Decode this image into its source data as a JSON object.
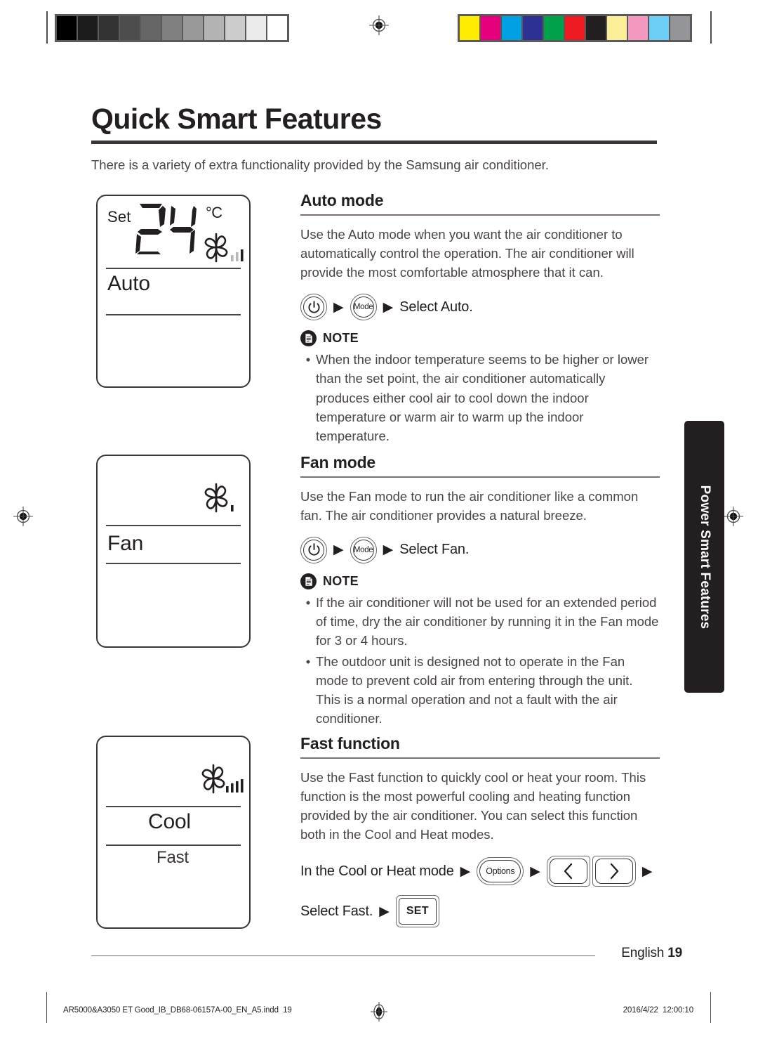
{
  "document": {
    "title": "Quick Smart Features",
    "intro": "There is a variety of extra functionality provided by the Samsung air conditioner.",
    "page_label": "English",
    "page_number": "19",
    "side_tab_label": "Power Smart Features"
  },
  "prepress": {
    "grayscale_swatches": [
      "#000000",
      "#1c1c1c",
      "#333333",
      "#4d4d4d",
      "#666666",
      "#808080",
      "#999999",
      "#b3b3b3",
      "#cccccc",
      "#ebebeb",
      "#ffffff"
    ],
    "color_swatches": [
      "#ffec00",
      "#e5007d",
      "#00a0e2",
      "#2e3192",
      "#00a14b",
      "#ed1c24",
      "#231f20",
      "#faee98",
      "#f49ac1",
      "#6dcef5",
      "#939598"
    ]
  },
  "panels": [
    {
      "name": "auto-panel",
      "set_label": "Set",
      "temperature": "24",
      "unit": "°C",
      "fan_icon": "fan-speed-icon",
      "fan_bars": 3,
      "fan_bars_active": 1,
      "mode_label": "Auto",
      "sub_label": ""
    },
    {
      "name": "fan-panel",
      "set_label": "",
      "temperature": "",
      "unit": "",
      "fan_icon": "fan-speed-icon",
      "fan_bars": 1,
      "fan_bars_active": 1,
      "mode_label": "Fan",
      "sub_label": ""
    },
    {
      "name": "cool-fast-panel",
      "set_label": "",
      "temperature": "",
      "unit": "",
      "fan_icon": "fan-speed-icon",
      "fan_bars": 4,
      "fan_bars_active": 4,
      "mode_label": "Cool",
      "sub_label": "Fast"
    }
  ],
  "sections": [
    {
      "id": "auto-mode",
      "heading": "Auto mode",
      "body": "Use the Auto mode when you want the air conditioner to automatically control the operation. The air conditioner will provide the most comfortable atmosphere that it can.",
      "steps": {
        "power_button": "power-icon",
        "mode_button": "Mode",
        "final_text": "Select Auto."
      },
      "note": {
        "title": "NOTE",
        "items": [
          "When the indoor temperature seems to be higher or lower than the set point, the air conditioner automatically produces either cool air to cool down the indoor temperature or warm air to warm up the indoor temperature."
        ]
      }
    },
    {
      "id": "fan-mode",
      "heading": "Fan mode",
      "body": "Use the Fan mode to run the air conditioner like a common fan. The air conditioner provides a natural breeze.",
      "steps": {
        "power_button": "power-icon",
        "mode_button": "Mode",
        "final_text": "Select Fan."
      },
      "note": {
        "title": "NOTE",
        "items": [
          "If the air conditioner will not be used for an extended period of time, dry the air conditioner by running it in the Fan mode for 3 or 4 hours.",
          "The outdoor unit is designed not to operate in the Fan mode to prevent cold air from entering through the unit. This is a normal operation and not a fault with the air conditioner."
        ]
      }
    },
    {
      "id": "fast-function",
      "heading": "Fast function",
      "body": "Use the Fast function to quickly cool or heat your room. This function is the most powerful cooling and heating function provided by the air conditioner. You can select this function both in the Cool and Heat modes.",
      "steps_fast": {
        "lead_text": "In the Cool or Heat mode",
        "options_button": "Options",
        "left_button": "chevron-left-icon",
        "right_button": "chevron-right-icon",
        "second_line_text": "Select Fast.",
        "set_button": "SET"
      }
    }
  ],
  "footer": {
    "slug_file": "AR5000&A3050 ET Good_IB_DB68-06157A-00_EN_A5.indd",
    "slug_page": "19",
    "slug_date": "2016/4/22",
    "slug_time": "12:00:10"
  },
  "colors": {
    "ink": "#231f20",
    "body_text": "#4a4446",
    "rule": "#6e6568",
    "tab_bg": "#231f20"
  }
}
